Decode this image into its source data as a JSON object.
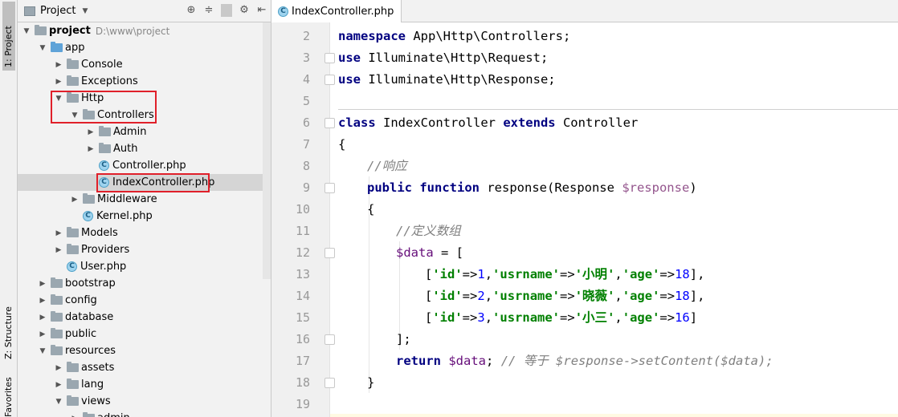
{
  "tool_strip": {
    "project": "1: Project",
    "structure": "Z: Structure",
    "favorites": "Favorites"
  },
  "project_panel": {
    "title": "Project",
    "tree": [
      {
        "label": "project",
        "path": "D:\\www\\project"
      },
      {
        "label": "app"
      },
      {
        "label": "Console"
      },
      {
        "label": "Exceptions"
      },
      {
        "label": "Http"
      },
      {
        "label": "Controllers"
      },
      {
        "label": "Admin"
      },
      {
        "label": "Auth"
      },
      {
        "label": "Controller.php"
      },
      {
        "label": "IndexController.php"
      },
      {
        "label": "Middleware"
      },
      {
        "label": "Kernel.php"
      },
      {
        "label": "Models"
      },
      {
        "label": "Providers"
      },
      {
        "label": "User.php"
      },
      {
        "label": "bootstrap"
      },
      {
        "label": "config"
      },
      {
        "label": "database"
      },
      {
        "label": "public"
      },
      {
        "label": "resources"
      },
      {
        "label": "assets"
      },
      {
        "label": "lang"
      },
      {
        "label": "views"
      },
      {
        "label": "admin"
      }
    ]
  },
  "editor": {
    "tab_label": "IndexController.php",
    "line_numbers": [
      "2",
      "3",
      "4",
      "5",
      "6",
      "7",
      "8",
      "9",
      "10",
      "11",
      "12",
      "13",
      "14",
      "15",
      "16",
      "17",
      "18",
      "19"
    ],
    "code": {
      "l2_kw": "namespace",
      "l2_rest": " App\\Http\\Controllers;",
      "l3_kw": "use",
      "l3_rest": " Illuminate\\Http\\Request;",
      "l4_kw": "use",
      "l4_rest": " Illuminate\\Http\\Response;",
      "l6_kw1": "class",
      "l6_name": " IndexController ",
      "l6_kw2": "extends",
      "l6_rest": " Controller",
      "l7": "{",
      "l8_cmt": "//响应",
      "l9_kw1": "public",
      "l9_kw2": "function",
      "l9_name": " response(Response ",
      "l9_var": "$response",
      "l9_end": ")",
      "l10": "{",
      "l11_cmt": "//定义数组",
      "l12_var": "$data",
      "l12_rest": " = [",
      "rows": [
        {
          "id": "1",
          "name": "小明",
          "age": "18",
          "end": "],"
        },
        {
          "id": "2",
          "name": "晓薇",
          "age": "18",
          "end": "],"
        },
        {
          "id": "3",
          "name": "小三",
          "age": "16",
          "end": "]"
        }
      ],
      "k_id": "'id'",
      "k_usrname": "'usrname'",
      "k_age": "'age'",
      "l16": "];",
      "l17_kw": "return",
      "l17_var": "$data",
      "l17_semi": ";",
      "l17_cmt": "// 等于 $response->setContent($data);",
      "l18": "}"
    }
  }
}
